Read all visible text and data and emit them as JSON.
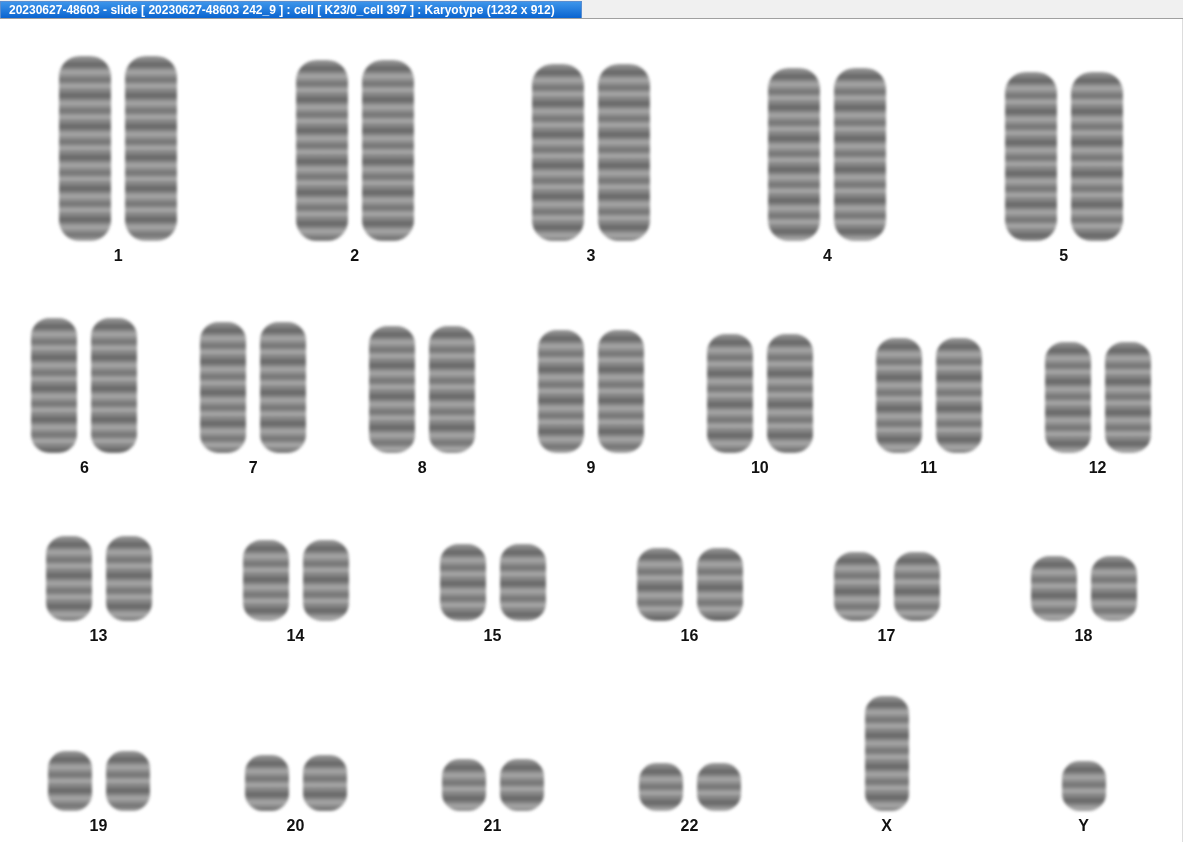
{
  "window": {
    "title": "20230627-48603 - slide [ 20230627-48603 242_9 ] : cell [ K23/0_cell 397 ] : Karyotype  (1232 x 912)"
  },
  "karyotype": {
    "rows": [
      {
        "chromosomes": [
          {
            "label": "1",
            "kind": "pair"
          },
          {
            "label": "2",
            "kind": "pair"
          },
          {
            "label": "3",
            "kind": "pair"
          },
          {
            "label": "4",
            "kind": "pair"
          },
          {
            "label": "5",
            "kind": "pair"
          }
        ]
      },
      {
        "chromosomes": [
          {
            "label": "6",
            "kind": "pair"
          },
          {
            "label": "7",
            "kind": "pair"
          },
          {
            "label": "8",
            "kind": "pair"
          },
          {
            "label": "9",
            "kind": "pair"
          },
          {
            "label": "10",
            "kind": "pair"
          },
          {
            "label": "11",
            "kind": "pair"
          },
          {
            "label": "12",
            "kind": "pair"
          }
        ]
      },
      {
        "chromosomes": [
          {
            "label": "13",
            "kind": "pair"
          },
          {
            "label": "14",
            "kind": "pair"
          },
          {
            "label": "15",
            "kind": "pair"
          },
          {
            "label": "16",
            "kind": "pair"
          },
          {
            "label": "17",
            "kind": "pair"
          },
          {
            "label": "18",
            "kind": "pair"
          }
        ]
      },
      {
        "chromosomes": [
          {
            "label": "19",
            "kind": "pair"
          },
          {
            "label": "20",
            "kind": "pair"
          },
          {
            "label": "21",
            "kind": "pair"
          },
          {
            "label": "22",
            "kind": "pair"
          },
          {
            "label": "X",
            "kind": "single"
          },
          {
            "label": "Y",
            "kind": "single"
          }
        ]
      }
    ]
  }
}
